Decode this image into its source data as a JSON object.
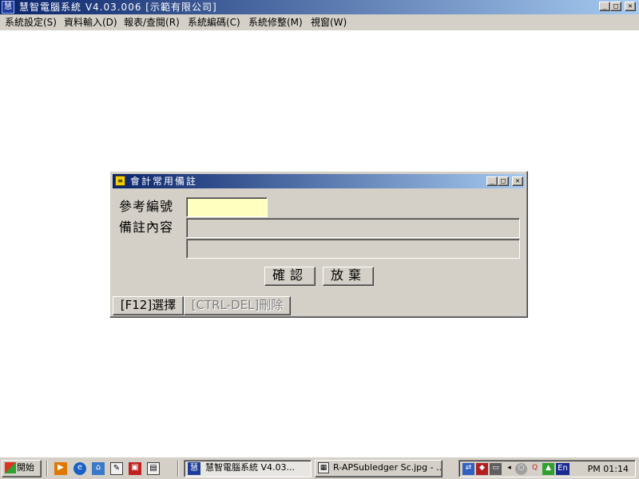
{
  "window": {
    "title": "慧智電腦系統 V4.03.006 [示範有限公司]",
    "icon_label": "慧",
    "minimize": "_",
    "maximize": "□",
    "close": "✕"
  },
  "menu": {
    "items": [
      {
        "label": "系統設定(S)"
      },
      {
        "label": "資料輸入(D)"
      },
      {
        "label": "報表/查閱(R)"
      },
      {
        "label": "系統編碼(C)"
      },
      {
        "label": "系統修整(M)"
      },
      {
        "label": "視窗(W)"
      }
    ]
  },
  "dialog": {
    "title": "會計常用備註",
    "minimize": "_",
    "maximize": "□",
    "close": "✕",
    "ref_label": "參考編號",
    "ref_value": "",
    "memo_label": "備註內容",
    "memo_line1": "",
    "memo_line2": "",
    "confirm_label": "確認",
    "cancel_label": "放棄",
    "f12_label": "[F12]選擇",
    "ctrl_del_label": "[CTRL-DEL]刪除",
    "ctrl_del_enabled": false
  },
  "taskbar": {
    "start_label": "開始",
    "tasks": [
      {
        "label": "慧智電腦系統 V4.03..."
      },
      {
        "label": "R-APSubledger Sc.jpg - ..."
      }
    ],
    "tray_lang": "En",
    "clock": "PM 01:14"
  },
  "colors": {
    "title_gradient_start": "#0a246a",
    "title_gradient_end": "#a6caf0",
    "face": "#d4d0c8",
    "input_highlight": "#ffffc0"
  }
}
